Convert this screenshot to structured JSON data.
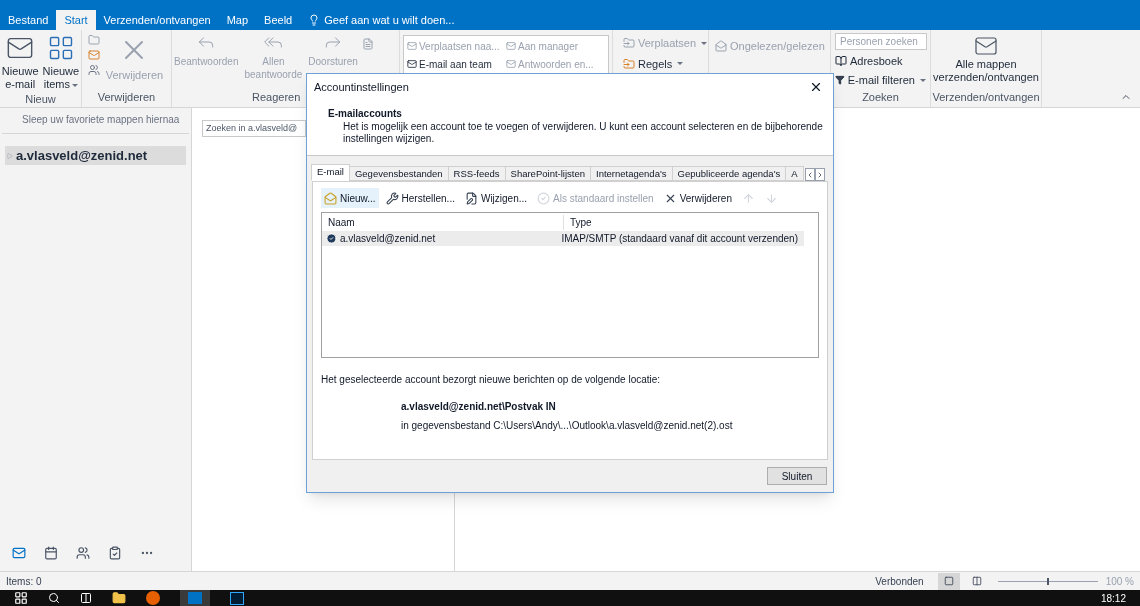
{
  "ribbon_tabs": [
    {
      "label": "Bestand",
      "selected": false
    },
    {
      "label": "Start",
      "selected": true
    },
    {
      "label": "Verzenden/ontvangen",
      "selected": false
    },
    {
      "label": "Map",
      "selected": false
    },
    {
      "label": "Beeld",
      "selected": false
    }
  ],
  "tell_me": "Geef aan wat u wilt doen...",
  "groups": {
    "nieuw": {
      "label": "Nieuw",
      "buttons": [
        {
          "lines": [
            "Nieuwe",
            "e-mail"
          ],
          "kind": "mail",
          "disabled": false,
          "dropdown": false
        },
        {
          "lines": [
            "Nieuwe",
            "items"
          ],
          "kind": "items",
          "disabled": false,
          "dropdown": true
        }
      ]
    },
    "verwijderen": {
      "label": "Verwijderen",
      "button": {
        "lines": [
          "Verwijderen"
        ],
        "kind": "delete",
        "disabled": true,
        "dropdown": false
      }
    },
    "reageren": {
      "label": "Reageren",
      "buttons": [
        {
          "lines": [
            "Beantwoorden"
          ],
          "kind": "reply",
          "disabled": true,
          "dropdown": false
        },
        {
          "lines": [
            "Allen",
            "beantwoorde"
          ],
          "kind": "replyall",
          "disabled": true,
          "dropdown": false
        },
        {
          "lines": [
            "Doorsturen"
          ],
          "kind": "forward",
          "disabled": true,
          "dropdown": false
        }
      ]
    },
    "quick_steps": [
      {
        "label": "Verplaatsen naa...",
        "disabled": true
      },
      {
        "label": "Aan manager",
        "disabled": true
      },
      {
        "label": "E-mail aan team",
        "disabled": false
      },
      {
        "label": "Antwoorden en...",
        "disabled": true
      }
    ],
    "verplaatsen": [
      {
        "label": "Verplaatsen",
        "disabled": true
      },
      {
        "label": "Regels",
        "disabled": false
      }
    ],
    "labels": [
      {
        "label": "Ongelezen/gelezen",
        "disabled": true
      }
    ],
    "zoeken": {
      "label": "Zoeken",
      "placeholder": "Personen zoeken",
      "items": [
        {
          "label": "Adresboek",
          "dropdown": false
        },
        {
          "label": "E-mail filteren",
          "dropdown": true
        }
      ]
    },
    "verzenden": {
      "label": "Verzenden/ontvangen",
      "lines": [
        "Alle mappen",
        "verzenden/ontvangen"
      ]
    }
  },
  "favorites_hint": "Sleep uw favoriete mappen hiernaa",
  "account_folder": {
    "label": "a.vlasveld@zenid.net",
    "selected": true
  },
  "search": {
    "placeholder": "Zoeken in a.vlasveld@"
  },
  "nav_items": [
    {
      "kind": "mail",
      "selected": true
    },
    {
      "kind": "calendar",
      "selected": false
    },
    {
      "kind": "people",
      "selected": false
    },
    {
      "kind": "tasks",
      "selected": false
    },
    {
      "kind": "more",
      "selected": false
    }
  ],
  "status_bar": {
    "items": "Items: 0",
    "connection": "Verbonden",
    "zoom": {
      "level": 0.5,
      "reading": "100 %"
    }
  },
  "taskbar": {
    "time": "18:12"
  },
  "dialog": {
    "title": "Accountinstellingen",
    "heading": "E-mailaccounts",
    "description": "Het is mogelijk een account toe te voegen of verwijderen. U kunt een account selecteren en de bijbehorende instellingen wijzigen.",
    "tabs": [
      {
        "label": "E-mail",
        "selected": true
      },
      {
        "label": "Gegevensbestanden",
        "selected": false
      },
      {
        "label": "RSS-feeds",
        "selected": false
      },
      {
        "label": "SharePoint-lijsten",
        "selected": false
      },
      {
        "label": "Internetagenda's",
        "selected": false
      },
      {
        "label": "Gepubliceerde agenda's",
        "selected": false
      },
      {
        "label": "A",
        "selected": false
      }
    ],
    "toolbar": [
      {
        "kind": "new",
        "label": "Nieuw...",
        "disabled": false
      },
      {
        "kind": "repair",
        "label": "Herstellen...",
        "disabled": false
      },
      {
        "kind": "change",
        "label": "Wijzigen...",
        "disabled": false
      },
      {
        "kind": "default",
        "label": "Als standaard instellen",
        "disabled": true
      },
      {
        "kind": "remove",
        "label": "Verwijderen",
        "disabled": false
      },
      {
        "kind": "up",
        "disabled": true
      },
      {
        "kind": "down",
        "disabled": true
      }
    ],
    "columns": [
      "Naam",
      "Type"
    ],
    "rows": [
      {
        "name": "a.vlasveld@zenid.net",
        "type": "IMAP/SMTP (standaard vanaf dit account verzenden)",
        "selected": true
      }
    ],
    "location_intro": "Het geselecteerde account bezorgt nieuwe berichten op de volgende locatie:",
    "location_folder": "a.vlasveld@zenid.net\\Postvak IN",
    "location_file": "in gegevensbestand C:\\Users\\Andy\\...\\Outlook\\a.vlasveld@zenid.net(2).ost",
    "close_button": "Sluiten"
  }
}
